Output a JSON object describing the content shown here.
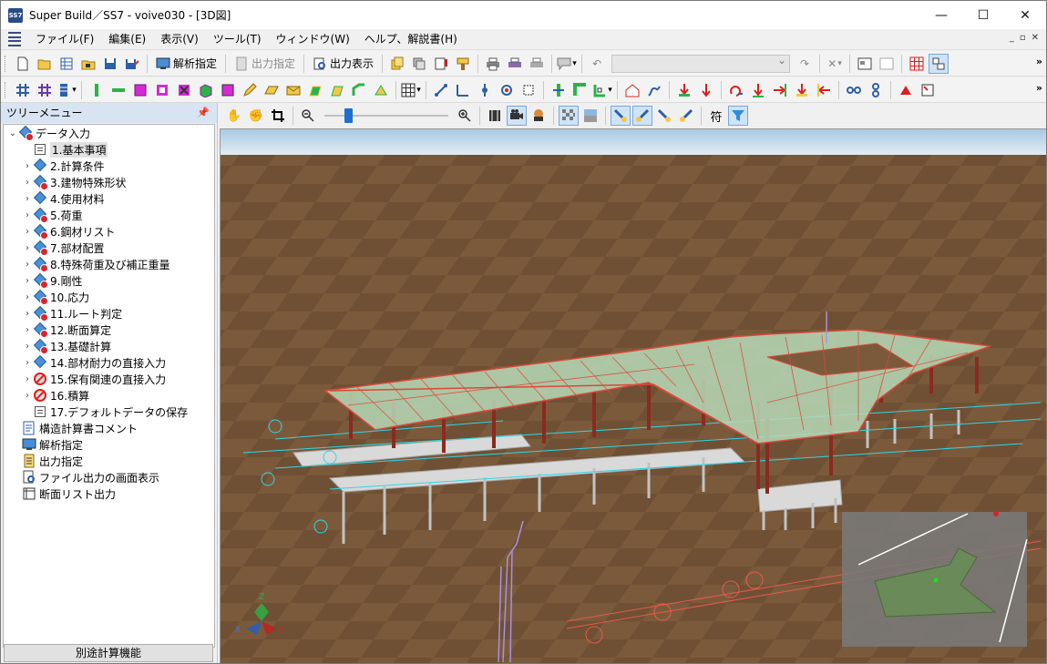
{
  "window": {
    "title": "Super Build／SS7 - voive030 - [3D図]",
    "app_icon_text": "SS7",
    "minimize": "—",
    "maximize": "☐",
    "close": "✕"
  },
  "menu": {
    "items": [
      "ファイル(F)",
      "編集(E)",
      "表示(V)",
      "ツール(T)",
      "ウィンドウ(W)",
      "ヘルプ、解説書(H)"
    ],
    "mdi": [
      "_",
      "▫",
      "✕"
    ]
  },
  "toolbar1": {
    "analysis_label": "解析指定",
    "output_label": "出力指定",
    "output_show_label": "出力表示"
  },
  "tree": {
    "header": "ツリーメニュー",
    "root": "データ入力",
    "items": [
      "1.基本事項",
      "2.計算条件",
      "3.建物特殊形状",
      "4.使用材料",
      "5.荷重",
      "6.鋼材リスト",
      "7.部材配置",
      "8.特殊荷重及び補正重量",
      "9.剛性",
      "10.応力",
      "11.ルート判定",
      "12.断面算定",
      "13.基礎計算",
      "14.部材耐力の直接入力",
      "15.保有関連の直接入力",
      "16.積算",
      "17.デフォルトデータの保存"
    ],
    "others": [
      "構造計算書コメント",
      "解析指定",
      "出力指定",
      "ファイル出力の画面表示",
      "断面リスト出力"
    ],
    "footer_button": "別途計算機能"
  },
  "viewtoolbar": {
    "symbol_button": "符"
  },
  "scene": {
    "axis_labels": {
      "z": "Z",
      "x": "X",
      "y": "Y"
    },
    "colors": {
      "ground": "#7b5a3c",
      "sky": "#cfe0ec",
      "roof": "#b7d9b7",
      "beam_red": "#d8493a",
      "column": "#8a2a20",
      "grid_cyan": "#30d6e8"
    }
  }
}
